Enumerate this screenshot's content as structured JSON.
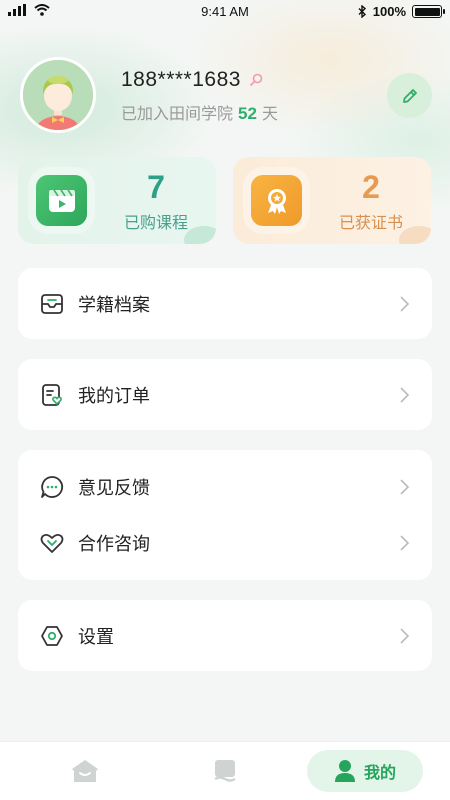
{
  "status_bar": {
    "time": "9:41 AM",
    "battery": "100%"
  },
  "profile": {
    "phone": "188****1683",
    "joined_prefix": "已加入田间学院",
    "joined_days": "52",
    "joined_suffix": "天",
    "icons": {
      "avatar": "cartoon-avatar",
      "search": "search-icon",
      "edit": "pencil-icon"
    }
  },
  "stats": [
    {
      "value": "7",
      "label": "已购课程",
      "icon": "video-clapper-icon"
    },
    {
      "value": "2",
      "label": "已获证书",
      "icon": "award-medal-icon"
    }
  ],
  "menu": {
    "records": {
      "label": "学籍档案",
      "icon": "inbox-tray-icon"
    },
    "orders": {
      "label": "我的订单",
      "icon": "order-list-icon"
    },
    "feedback": {
      "label": "意见反馈",
      "icon": "chat-bubble-icon"
    },
    "cooperation": {
      "label": "合作咨询",
      "icon": "handshake-heart-icon"
    },
    "settings": {
      "label": "设置",
      "icon": "hexagon-settings-icon"
    }
  },
  "tab_bar": {
    "home_icon": "home-icon",
    "courses_icon": "book-icon",
    "mine_label": "我的",
    "mine_icon": "person-icon"
  },
  "colors": {
    "accent_green": "#2fae6b",
    "stat_green": "#2ea08a",
    "stat_orange": "#e89a52",
    "background": "#f3f6f4"
  }
}
